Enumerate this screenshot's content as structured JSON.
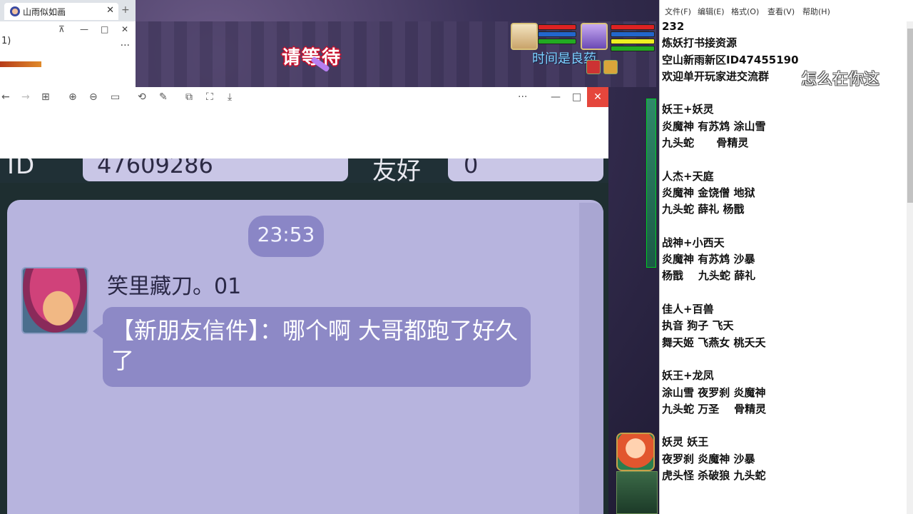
{
  "browser": {
    "tab_title": "山雨似如画",
    "tab_close": "✕",
    "tab_new": "+"
  },
  "small_window": {
    "title": "1)",
    "pin": "⊼",
    "minimize": "—",
    "maximize": "□",
    "close": "✕",
    "more": "···"
  },
  "game": {
    "wait_text": "请等待",
    "hud_text": "时间是良药"
  },
  "viewer": {
    "toolbar_icons": [
      "back-icon",
      "forward-icon",
      "grid-icon",
      "zoom-in-icon",
      "zoom-out-icon",
      "fit-icon",
      "rotate-icon",
      "edit-icon",
      "crop-icon",
      "fullscreen-icon",
      "download-icon"
    ],
    "back": "←",
    "forward": "→",
    "grid": "⊞",
    "zoom_in": "⊕",
    "zoom_out": "⊖",
    "fit": "▭",
    "rotate": "⟲",
    "edit": "✎",
    "crop": "⧉",
    "fullscreen": "⛶",
    "download": "⤓",
    "more": "···",
    "minimize": "—",
    "maximize": "□",
    "close": "✕"
  },
  "screenshot": {
    "id_label": "ID",
    "id_value": "47609286",
    "friend_label": "友好",
    "friend_value": "0",
    "time": "23:53",
    "sender": "笑里藏刀。01",
    "message": "【新朋友信件】：哪个啊 大哥都跑了好久了"
  },
  "notepad": {
    "menu": [
      "文件(F)",
      "编辑(E)",
      "格式(O)",
      "查看(V)",
      "帮助(H)"
    ],
    "watermark": "怎么在你这",
    "text": "232\n炼妖打书接资源\n空山新雨新区ID47455190\n欢迎单开玩家进交流群\n\n妖王+妖灵\n炎魔神 有苏鸩 涂山雪\n九头蛇      骨精灵\n\n人杰+天庭\n炎魔神 金饶僧 地狱\n九头蛇 薛礼 杨戬\n\n战神+小西天\n炎魔神 有苏鸩 沙暴\n杨戬    九头蛇 薛礼\n\n佳人+百兽\n执音 狗子 飞天\n舞天姬 飞燕女 桃夭夭\n\n妖王+龙凤\n涂山雪 夜罗刹 炎魔神\n九头蛇 万圣    骨精灵\n\n妖灵 妖王\n夜罗刹 炎魔神 沙暴\n虎头怪 杀破狼 九头蛇"
  }
}
